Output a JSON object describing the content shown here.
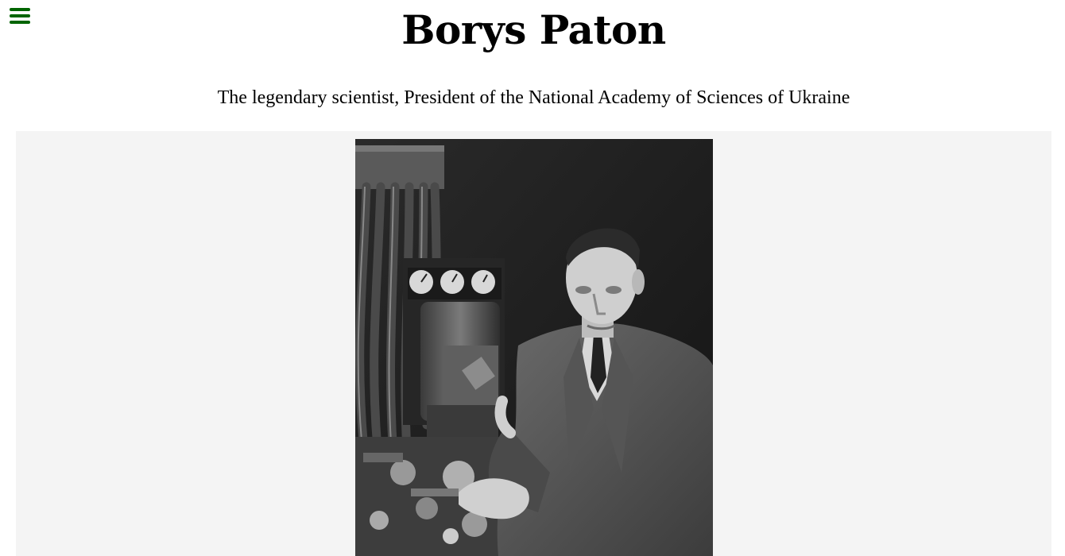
{
  "header": {
    "menu_icon": "hamburger-menu-icon",
    "title": "Borys Paton",
    "subtitle": "The legendary scientist, President of the National Academy of Sciences of Ukraine"
  },
  "colors": {
    "menu_icon": "#006400",
    "panel_background": "#f4f4f4",
    "text": "#000000"
  },
  "photo": {
    "alt": "Borys Paton",
    "style": "black-and-white"
  }
}
